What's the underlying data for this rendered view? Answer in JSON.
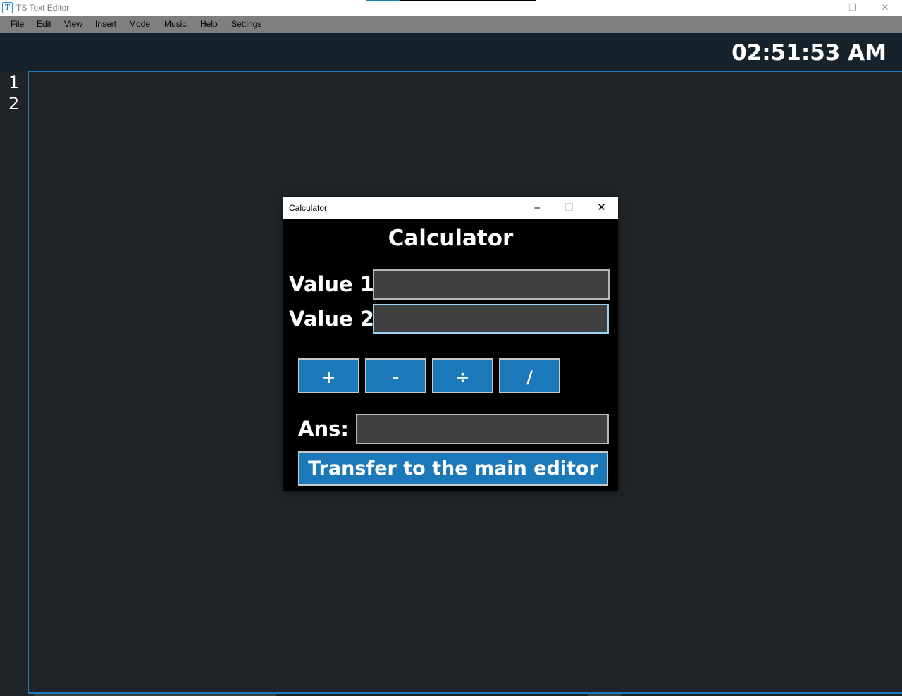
{
  "app": {
    "title": "TS Text Editor",
    "icon": "T"
  },
  "window_controls": {
    "minimize": "–",
    "restore": "❐",
    "close": "✕"
  },
  "menu": [
    "File",
    "Edit",
    "View",
    "Insert",
    "Mode",
    "Music",
    "Help",
    "Settings"
  ],
  "clock": "02:51:53 AM",
  "editor": {
    "line_numbers": [
      "1",
      "2"
    ],
    "content": ""
  },
  "calculator": {
    "window_title": "Calculator",
    "controls": {
      "minimize": "–",
      "maximize": "☐",
      "close": "✕"
    },
    "heading": "Calculator",
    "value1_label": "Value 1:",
    "value1": "",
    "value2_label": "Value 2:",
    "value2": "",
    "operations": [
      "+",
      "-",
      "÷",
      "/"
    ],
    "ans_label": "Ans:",
    "ans": "",
    "transfer_label": "Transfer to the main editor"
  },
  "colors": {
    "accent": "#1b78b9",
    "background": "#202428",
    "header": "#17232c",
    "menubar": "#7f7f7f"
  }
}
